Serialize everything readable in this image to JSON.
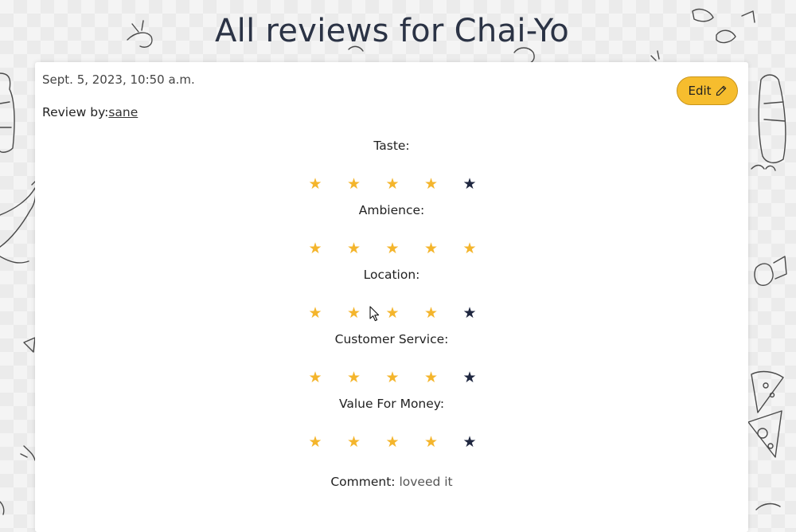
{
  "page": {
    "title": "All reviews for Chai-Yo"
  },
  "review": {
    "date": "Sept. 5, 2023, 10:50 a.m.",
    "reviewed_by_label": "Review by:",
    "reviewer": "sane",
    "edit_label": "Edit",
    "ratings": [
      {
        "label": "Taste:",
        "score": 4,
        "max": 5
      },
      {
        "label": "Ambience:",
        "score": 5,
        "max": 5
      },
      {
        "label": "Location:",
        "score": 4,
        "max": 5
      },
      {
        "label": "Customer Service:",
        "score": 4,
        "max": 5
      },
      {
        "label": "Value For Money:",
        "score": 4,
        "max": 5
      }
    ],
    "comment_label": "Comment:",
    "comment": "loveed it"
  },
  "colors": {
    "star_filled": "#f4b52c",
    "star_empty": "#1f2740",
    "edit_button": "#f6bd2e",
    "title": "#2b3345"
  },
  "icons": {
    "edit": "pencil-icon",
    "star": "star-icon",
    "cursor": "mouse-pointer-icon"
  }
}
